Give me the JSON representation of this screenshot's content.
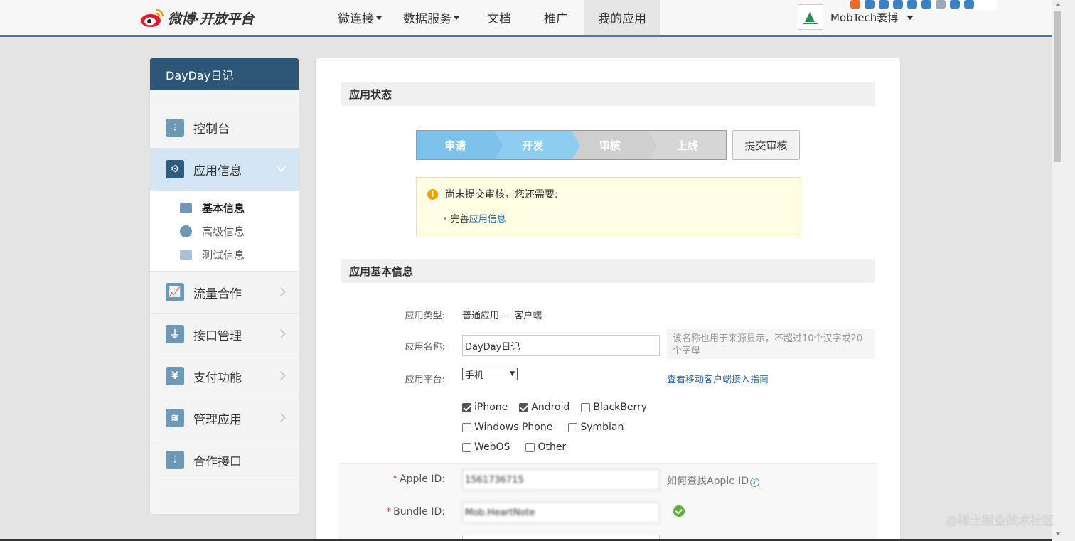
{
  "header": {
    "brand": "微博·开放平台",
    "nav": [
      {
        "label": "微连接",
        "dropdown": true
      },
      {
        "label": "数据服务",
        "dropdown": true
      },
      {
        "label": "文档",
        "dropdown": false
      },
      {
        "label": "推广",
        "dropdown": false
      },
      {
        "label": "我的应用",
        "dropdown": false,
        "active": true
      }
    ],
    "user_name": "MobTech袤博"
  },
  "sidebar": {
    "app_name": "DayDay日记",
    "items": [
      {
        "label": "控制台",
        "icon": "sliders-icon"
      },
      {
        "label": "应用信息",
        "icon": "gear-icon",
        "active": true
      },
      {
        "label": "流量合作",
        "icon": "chart-icon"
      },
      {
        "label": "接口管理",
        "icon": "plug-icon"
      },
      {
        "label": "支付功能",
        "icon": "yen-icon"
      },
      {
        "label": "管理应用",
        "icon": "layers-icon"
      },
      {
        "label": "合作接口",
        "icon": "sliders-icon"
      }
    ],
    "sub_items": [
      {
        "label": "基本信息",
        "icon": "card-icon",
        "active": true
      },
      {
        "label": "高级信息",
        "icon": "info-icon"
      },
      {
        "label": "测试信息",
        "icon": "id-icon"
      }
    ]
  },
  "status": {
    "section_title": "应用状态",
    "steps": [
      {
        "label": "申请",
        "done": true
      },
      {
        "label": "开发",
        "done": true
      },
      {
        "label": "审核",
        "done": false
      },
      {
        "label": "上线",
        "done": false
      }
    ],
    "submit_label": "提交审核",
    "notice_title": "尚未提交审核，您还需要:",
    "notice_prefix": "完善",
    "notice_link": "应用信息"
  },
  "basic": {
    "section_title": "应用基本信息",
    "type_label": "应用类型:",
    "type_value": "普通应用  -  客户端",
    "name_label": "应用名称:",
    "name_value": "DayDay日记",
    "name_hint": "该名称也用于来源显示，不超过10个汉字或20个字母",
    "platform_label": "应用平台:",
    "platform_value": "手机",
    "guide_link": "查看移动客户端接入指南",
    "platforms": [
      {
        "label": "iPhone",
        "checked": true
      },
      {
        "label": "Android",
        "checked": true
      },
      {
        "label": "BlackBerry",
        "checked": false
      },
      {
        "label": "Windows Phone",
        "checked": false
      },
      {
        "label": "Symbian",
        "checked": false
      },
      {
        "label": "WebOS",
        "checked": false
      },
      {
        "label": "Other",
        "checked": false
      }
    ],
    "apple_id_label": "Apple ID:",
    "apple_id_value": "1561736715",
    "apple_id_help": "如何查找Apple ID",
    "bundle_id_label": "Bundle ID:",
    "bundle_id_value": "Mob.HeartNote"
  },
  "watermark": "@稀土掘金技术社区",
  "colors": {
    "nav_accent": "#3a7bb8",
    "sidebar_header": "#2c5576",
    "step_done": "#7cc2ea",
    "link": "#2b6cb0"
  }
}
